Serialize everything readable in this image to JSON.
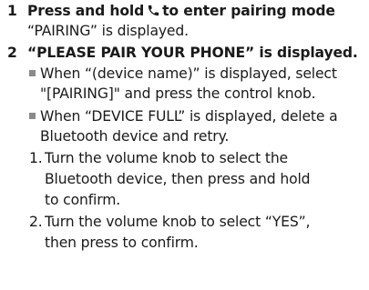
{
  "steps": [
    {
      "number": "1",
      "heading_before_icon": "Press and hold",
      "icon": "phone-icon",
      "heading_after_icon": "to enter pairing mode",
      "body": "“PAIRING” is displayed."
    },
    {
      "number": "2",
      "heading": "“PLEASE PAIR YOUR PHONE” is displayed.",
      "bullets": [
        {
          "lines": [
            "When “(device name)” is displayed, select",
            "\"[PAIRING]\" and press the control knob."
          ]
        },
        {
          "lines": [
            "When “DEVICE FULL” is displayed, delete a",
            "Bluetooth device and retry."
          ]
        }
      ],
      "substeps": [
        {
          "number": "1.",
          "lines": [
            "Turn the volume knob to select the",
            "Bluetooth device, then press and hold",
            "to confirm."
          ]
        },
        {
          "number": "2.",
          "lines": [
            "Turn the volume knob to select “YES”,",
            "then press to confirm."
          ]
        }
      ]
    }
  ]
}
